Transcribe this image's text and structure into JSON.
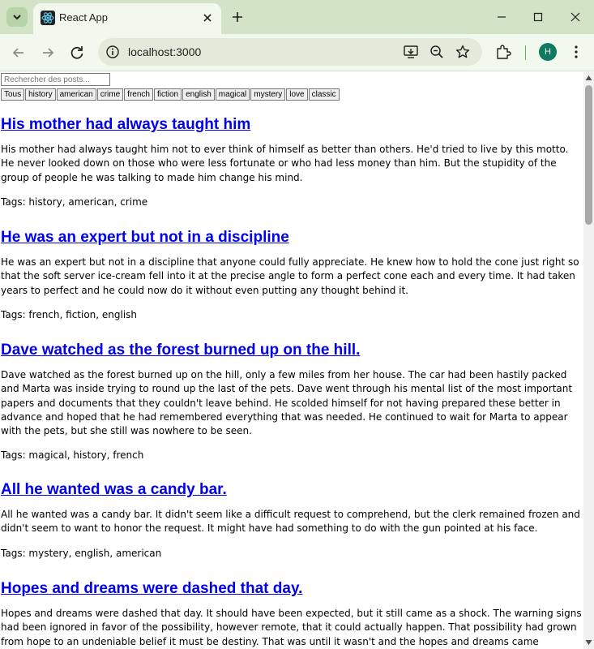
{
  "browser": {
    "tab_title": "React App",
    "url": "localhost:3000",
    "profile_initial": "H"
  },
  "page": {
    "search_placeholder": "Rechercher des posts...",
    "tag_buttons": [
      "Tous",
      "history",
      "american",
      "crime",
      "french",
      "fiction",
      "english",
      "magical",
      "mystery",
      "love",
      "classic"
    ],
    "posts": [
      {
        "title": "His mother had always taught him",
        "body": "His mother had always taught him not to ever think of himself as better than others. He'd tried to live by this motto. He never looked down on those who were less fortunate or who had less money than him. But the stupidity of the group of people he was talking to made him change his mind.",
        "tags": "Tags: history, american, crime"
      },
      {
        "title": "He was an expert but not in a discipline",
        "body": "He was an expert but not in a discipline that anyone could fully appreciate. He knew how to hold the cone just right so that the soft server ice-cream fell into it at the precise angle to form a perfect cone each and every time. It had taken years to perfect and he could now do it without even putting any thought behind it.",
        "tags": "Tags: french, fiction, english"
      },
      {
        "title": "Dave watched as the forest burned up on the hill.",
        "body": "Dave watched as the forest burned up on the hill, only a few miles from her house. The car had been hastily packed and Marta was inside trying to round up the last of the pets. Dave went through his mental list of the most important papers and documents that they couldn't leave behind. He scolded himself for not having prepared these better in advance and hoped that he had remembered everything that was needed. He continued to wait for Marta to appear with the pets, but she still was nowhere to be seen.",
        "tags": "Tags: magical, history, french"
      },
      {
        "title": "All he wanted was a candy bar.",
        "body": "All he wanted was a candy bar. It didn't seem like a difficult request to comprehend, but the clerk remained frozen and didn't seem to want to honor the request. It might have had something to do with the gun pointed at his face.",
        "tags": "Tags: mystery, english, american"
      },
      {
        "title": "Hopes and dreams were dashed that day.",
        "body": "Hopes and dreams were dashed that day. It should have been expected, but it still came as a shock. The warning signs had been ignored in favor of the possibility, however remote, that it could actually happen. That possibility had grown from hope to an undeniable belief it must be destiny. That was until it wasn't and the hopes and dreams came crashing down.",
        "tags": ""
      }
    ]
  }
}
